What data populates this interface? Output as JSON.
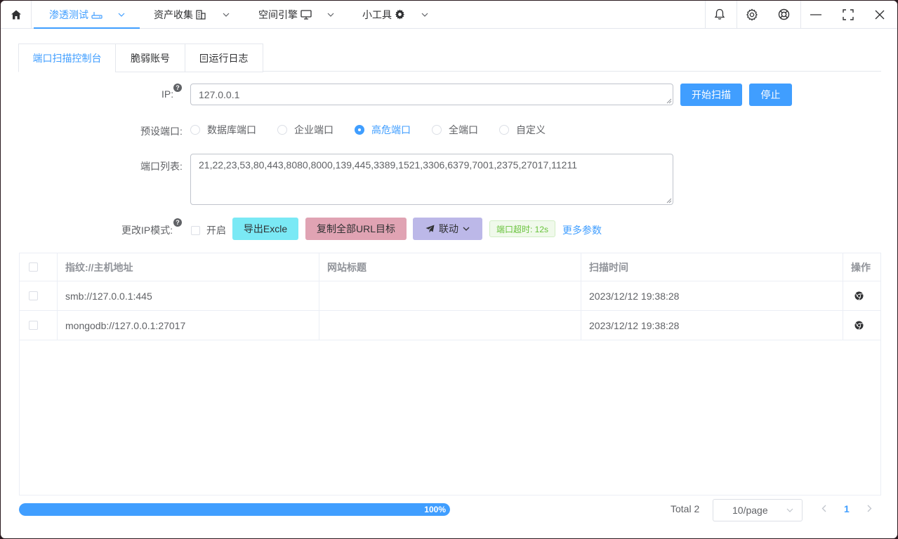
{
  "topbar": {
    "menu": [
      {
        "label": "渗透测试",
        "icon": "server-icon"
      },
      {
        "label": "资产收集",
        "icon": "building-icon"
      },
      {
        "label": "空间引擎",
        "icon": "monitor-icon"
      },
      {
        "label": "小工具",
        "icon": "gear-icon"
      }
    ],
    "active_menu": "渗透测试",
    "right_icons": [
      "bell-icon",
      "settings-icon",
      "lifebuoy-icon",
      "minimize-icon",
      "maximize-icon",
      "close-icon"
    ]
  },
  "tabs": [
    {
      "label": "端口扫描控制台"
    },
    {
      "label": "脆弱账号"
    },
    {
      "label": "运行日志"
    }
  ],
  "active_tab": "端口扫描控制台",
  "form": {
    "ip_label": "IP:",
    "ip_value": "127.0.0.1",
    "start_button": "开始扫描",
    "stop_button": "停止",
    "preset_label": "预设端口:",
    "presets": [
      "数据库端口",
      "企业端口",
      "高危端口",
      "全端口",
      "自定义"
    ],
    "preset_selected": "高危端口",
    "ports_label": "端口列表:",
    "ports_value": "21,22,23,53,80,443,8080,8000,139,445,3389,1521,3306,6379,7001,2375,27017,11211",
    "ip_mode_label": "更改IP模式:",
    "ip_mode_checkbox": "开启",
    "export_button": "导出Excle",
    "copy_button": "复制全部URL目标",
    "link_button": "联动",
    "timeout_tag": "端口超时: 12s",
    "more_params_link": "更多参数",
    "colors": {
      "accent": "#409eff",
      "export_bg": "#7ae9f5",
      "copy_bg": "#e0a3b3",
      "link_bg": "#bcb8e8"
    }
  },
  "table": {
    "columns": [
      "指纹://主机地址",
      "网站标题",
      "扫描时间",
      "操作"
    ],
    "rows": [
      {
        "address": "smb://127.0.0.1:445",
        "title": "",
        "time": "2023/12/12 19:38:28",
        "action_icon": "chrome-icon"
      },
      {
        "address": "mongodb://127.0.0.1:27017",
        "title": "",
        "time": "2023/12/12 19:38:28",
        "action_icon": "chrome-icon"
      }
    ]
  },
  "progress": {
    "percent": 100,
    "label": "100%"
  },
  "pagination": {
    "total": "Total 2",
    "page_size": "10/page",
    "current_page": "1"
  }
}
